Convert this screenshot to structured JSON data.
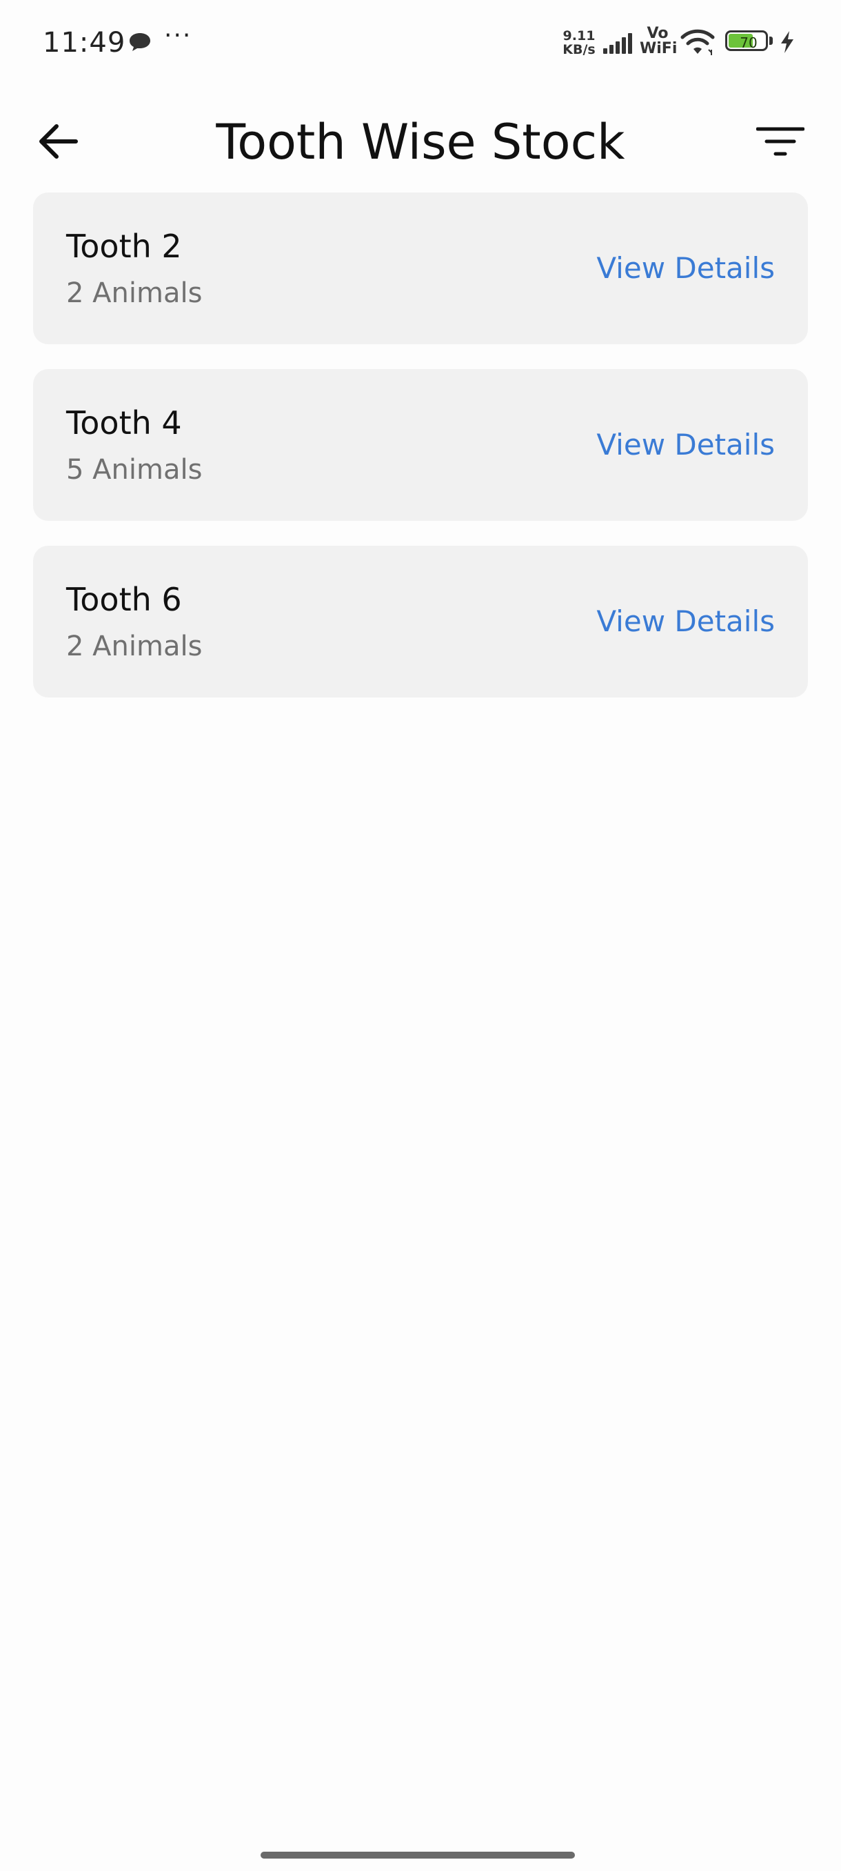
{
  "status_bar": {
    "time": "11:49",
    "more": "···",
    "net_speed_value": "9.11",
    "net_speed_unit": "KB/s",
    "vo": "Vo",
    "wifi_label": "WiFi",
    "battery_percent": "70",
    "battery_level": 0.7,
    "icons": [
      "message-bubble-icon",
      "cellular-signal-icon",
      "wifi-icon",
      "battery-icon",
      "charging-bolt-icon"
    ]
  },
  "app_bar": {
    "title": "Tooth Wise Stock",
    "back_icon": "arrow-left-icon",
    "filter_icon": "filter-lines-icon"
  },
  "items": [
    {
      "title": "Tooth 2",
      "subtitle": "2 Animals",
      "action": "View Details"
    },
    {
      "title": "Tooth 4",
      "subtitle": "5 Animals",
      "action": "View Details"
    },
    {
      "title": "Tooth 6",
      "subtitle": "2 Animals",
      "action": "View Details"
    }
  ],
  "colors": {
    "link": "#3a7bd5",
    "card_background": "#f1f1f1",
    "battery_fill": "#6cc33a",
    "subtitle": "#707070"
  }
}
